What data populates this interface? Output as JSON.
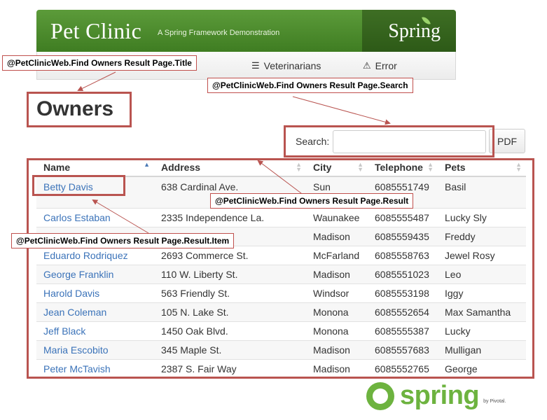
{
  "header": {
    "logo": "Pet Clinic",
    "tagline": "A Spring Framework Demonstration",
    "brand": "Spring"
  },
  "nav": {
    "items": [
      {
        "label": "Veterinarians",
        "icon": "list-icon"
      },
      {
        "label": "Error",
        "icon": "warning-icon"
      }
    ]
  },
  "page": {
    "title": "Owners"
  },
  "search": {
    "label": "Search:",
    "value": "",
    "pdf_label": "PDF"
  },
  "table": {
    "headers": [
      "Name",
      "Address",
      "City",
      "Telephone",
      "Pets"
    ],
    "sorted_column": "Name",
    "rows": [
      {
        "name": "Betty Davis",
        "address": "638 Cardinal Ave.",
        "city": "Sun",
        "telephone": "6085551749",
        "pets": "Basil"
      },
      {
        "name": "Carlos Estaban",
        "address": "2335 Independence La.",
        "city": "Waunakee",
        "telephone": "6085555487",
        "pets": "Lucky Sly"
      },
      {
        "name": "",
        "address": "",
        "city": "Madison",
        "telephone": "6085559435",
        "pets": "Freddy"
      },
      {
        "name": "Eduardo Rodriquez",
        "address": "2693 Commerce St.",
        "city": "McFarland",
        "telephone": "6085558763",
        "pets": "Jewel Rosy"
      },
      {
        "name": "George Franklin",
        "address": "110 W. Liberty St.",
        "city": "Madison",
        "telephone": "6085551023",
        "pets": "Leo"
      },
      {
        "name": "Harold Davis",
        "address": "563 Friendly St.",
        "city": "Windsor",
        "telephone": "6085553198",
        "pets": "Iggy"
      },
      {
        "name": "Jean Coleman",
        "address": "105 N. Lake St.",
        "city": "Monona",
        "telephone": "6085552654",
        "pets": "Max Samantha"
      },
      {
        "name": "Jeff Black",
        "address": "1450 Oak Blvd.",
        "city": "Monona",
        "telephone": "6085555387",
        "pets": "Lucky"
      },
      {
        "name": "Maria Escobito",
        "address": "345 Maple St.",
        "city": "Madison",
        "telephone": "6085557683",
        "pets": "Mulligan"
      },
      {
        "name": "Peter McTavish",
        "address": "2387 S. Fair Way",
        "city": "Madison",
        "telephone": "6085552765",
        "pets": "George"
      }
    ]
  },
  "annotations": {
    "title": "@PetClinicWeb.Find Owners Result Page.Title",
    "search": "@PetClinicWeb.Find Owners Result Page.Search",
    "result": "@PetClinicWeb.Find Owners Result Page.Result",
    "result_item": "@PetClinicWeb.Find Owners Result Page.Result.Item"
  },
  "footer": {
    "brand": "spring",
    "by": "by Pivotal."
  },
  "colors": {
    "banner_green": "#4a8a2c",
    "link_blue": "#3b73b9",
    "annotation_red": "#b95450",
    "spring_green": "#6db33f"
  }
}
